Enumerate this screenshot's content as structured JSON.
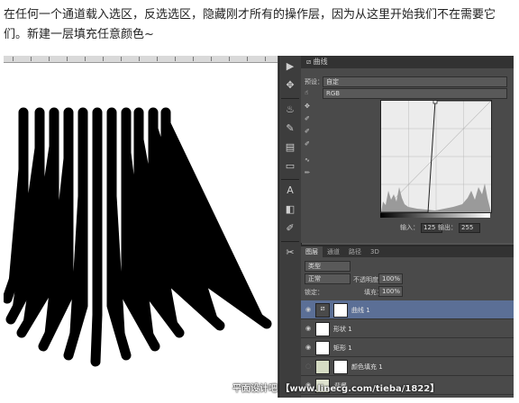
{
  "intro_text": "在任何一个通道载入选区，反选选区，隐藏刚才所有的操作层，因为从这里开始我们不在需要它们。新建一层填充任意颜色~",
  "tool_strip": {
    "icons": [
      "play-icon",
      "move-icon",
      "text-icon",
      "history-brush-icon",
      "brush-icon",
      "clone-stamp-icon",
      "eraser-icon",
      "type-icon",
      "paths-icon",
      "eyedropper-icon",
      "transform-icon"
    ]
  },
  "properties": {
    "panel_title": "曲线",
    "preset_label": "预设：",
    "preset_value": "自定",
    "channel_value": "RGB",
    "input_label": "输入：",
    "input_value": "125",
    "output_label": "输出：",
    "output_value": "255"
  },
  "layers_panel": {
    "tabs": [
      "图层",
      "通道",
      "路径",
      "3D"
    ],
    "filter_kind": "类型",
    "blend_mode": "正常",
    "opacity_label": "不透明度：",
    "opacity_value": "100%",
    "lock_label": "锁定：",
    "fill_label": "填充：",
    "fill_value": "100%",
    "layers": [
      {
        "name": "曲线 1",
        "active": true
      },
      {
        "name": "形状 1",
        "active": false
      },
      {
        "name": "矩形 1",
        "active": false
      },
      {
        "name": "颜色填充 1",
        "active": false
      },
      {
        "name": "背景",
        "active": false
      }
    ]
  },
  "watermark": "平面设计吧 【www.linecg.com/tieba/1822】"
}
